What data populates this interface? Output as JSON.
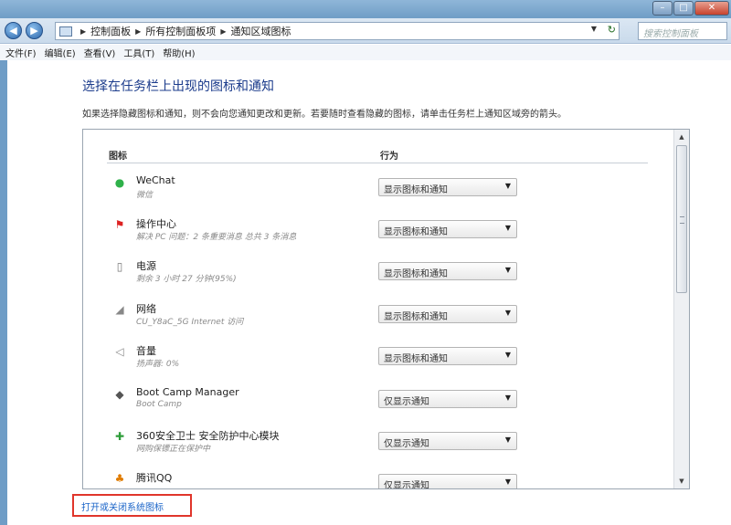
{
  "window": {
    "controls": [
      "minimize",
      "maximize",
      "close"
    ]
  },
  "address": {
    "crumbs": [
      "控制面板",
      "所有控制面板项",
      "通知区域图标"
    ],
    "search_placeholder": "搜索控制面板"
  },
  "menu": [
    "文件(F)",
    "编辑(E)",
    "查看(V)",
    "工具(T)",
    "帮助(H)"
  ],
  "main": {
    "heading": "选择在任务栏上出现的图标和通知",
    "description": "如果选择隐藏图标和通知，则不会向您通知更改和更新。若要随时查看隐藏的图标，请单击任务栏上通知区域旁的箭头。",
    "col_icon": "图标",
    "col_behavior": "行为",
    "link": "打开或关闭系统图标"
  },
  "rows": [
    {
      "name": "WeChat",
      "sub": "微信",
      "behavior": "显示图标和通知",
      "icon": "wechat-icon"
    },
    {
      "name": "操作中心",
      "sub": "解决 PC 问题：2 条重要消息 总共 3 条消息",
      "behavior": "显示图标和通知",
      "icon": "action-center-icon"
    },
    {
      "name": "电源",
      "sub": "剩余 3 小时 27 分钟(95%)",
      "behavior": "显示图标和通知",
      "icon": "battery-icon"
    },
    {
      "name": "网络",
      "sub": "CU_Y8aC_5G Internet 访问",
      "behavior": "显示图标和通知",
      "icon": "network-icon"
    },
    {
      "name": "音量",
      "sub": "扬声器: 0%",
      "behavior": "显示图标和通知",
      "icon": "volume-icon"
    },
    {
      "name": "Boot Camp Manager",
      "sub": "Boot Camp",
      "behavior": "仅显示通知",
      "icon": "bootcamp-icon"
    },
    {
      "name": "360安全卫士 安全防护中心模块",
      "sub": "网购保镖正在保护中",
      "behavior": "仅显示通知",
      "icon": "360-safe-icon"
    },
    {
      "name": "腾讯QQ",
      "sub": "",
      "behavior": "仅显示通知",
      "icon": "qq-icon"
    }
  ],
  "colors": {
    "heading": "#1c3c8c",
    "link": "#1a64c8",
    "highlight_box": "#e0352b"
  }
}
